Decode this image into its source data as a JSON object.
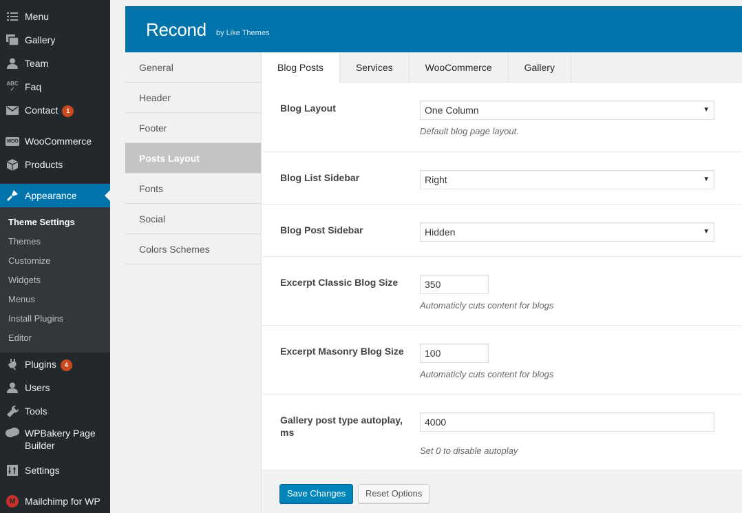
{
  "admin_menu": {
    "items_top": [
      {
        "label": "Menu",
        "icon": "menu-icon"
      },
      {
        "label": "Gallery",
        "icon": "gallery-icon"
      },
      {
        "label": "Team",
        "icon": "team-icon"
      },
      {
        "label": "Faq",
        "icon": "faq-icon"
      },
      {
        "label": "Contact",
        "icon": "contact-icon",
        "badge": "1"
      },
      {
        "label": "WooCommerce",
        "icon": "woocommerce-icon"
      },
      {
        "label": "Products",
        "icon": "products-icon"
      },
      {
        "label": "Appearance",
        "icon": "appearance-icon"
      }
    ],
    "submenu": [
      "Theme Settings",
      "Themes",
      "Customize",
      "Widgets",
      "Menus",
      "Install Plugins",
      "Editor"
    ],
    "items_bottom": [
      {
        "label": "Plugins",
        "icon": "plugins-icon",
        "badge": "4"
      },
      {
        "label": "Users",
        "icon": "users-icon"
      },
      {
        "label": "Tools",
        "icon": "tools-icon"
      },
      {
        "label": "WPBakery Page Builder",
        "icon": "wpbakery-icon"
      },
      {
        "label": "Settings",
        "icon": "settings-icon"
      },
      {
        "label": "Mailchimp for WP",
        "icon": "mailchimp-icon"
      }
    ],
    "colors": {
      "bg": "#23282d",
      "submenu_bg": "#32373c",
      "current": "#0073aa",
      "badge": "#ca4a1f"
    }
  },
  "theme": {
    "title": "Recond",
    "by": "by Like Themes",
    "header_color": "#0073aa"
  },
  "side_nav": [
    "General",
    "Header",
    "Footer",
    "Posts Layout",
    "Fonts",
    "Social",
    "Colors Schemes"
  ],
  "tabs": [
    "Blog Posts",
    "Services",
    "WooCommerce",
    "Gallery"
  ],
  "fields": {
    "blog_layout": {
      "label": "Blog Layout",
      "value": "One Column",
      "desc": "Default blog page layout."
    },
    "blog_list_sidebar": {
      "label": "Blog List Sidebar",
      "value": "Right"
    },
    "blog_post_sidebar": {
      "label": "Blog Post Sidebar",
      "value": "Hidden"
    },
    "excerpt_classic": {
      "label": "Excerpt Classic Blog Size",
      "value": "350",
      "desc": "Automaticly cuts content for blogs"
    },
    "excerpt_masonry": {
      "label": "Excerpt Masonry Blog Size",
      "value": "100",
      "desc": "Automaticly cuts content for blogs"
    },
    "gallery_autoplay": {
      "label": "Gallery post type autoplay, ms",
      "value": "4000",
      "desc": "Set 0 to disable autoplay"
    }
  },
  "buttons": {
    "save": "Save Changes",
    "reset": "Reset Options"
  }
}
